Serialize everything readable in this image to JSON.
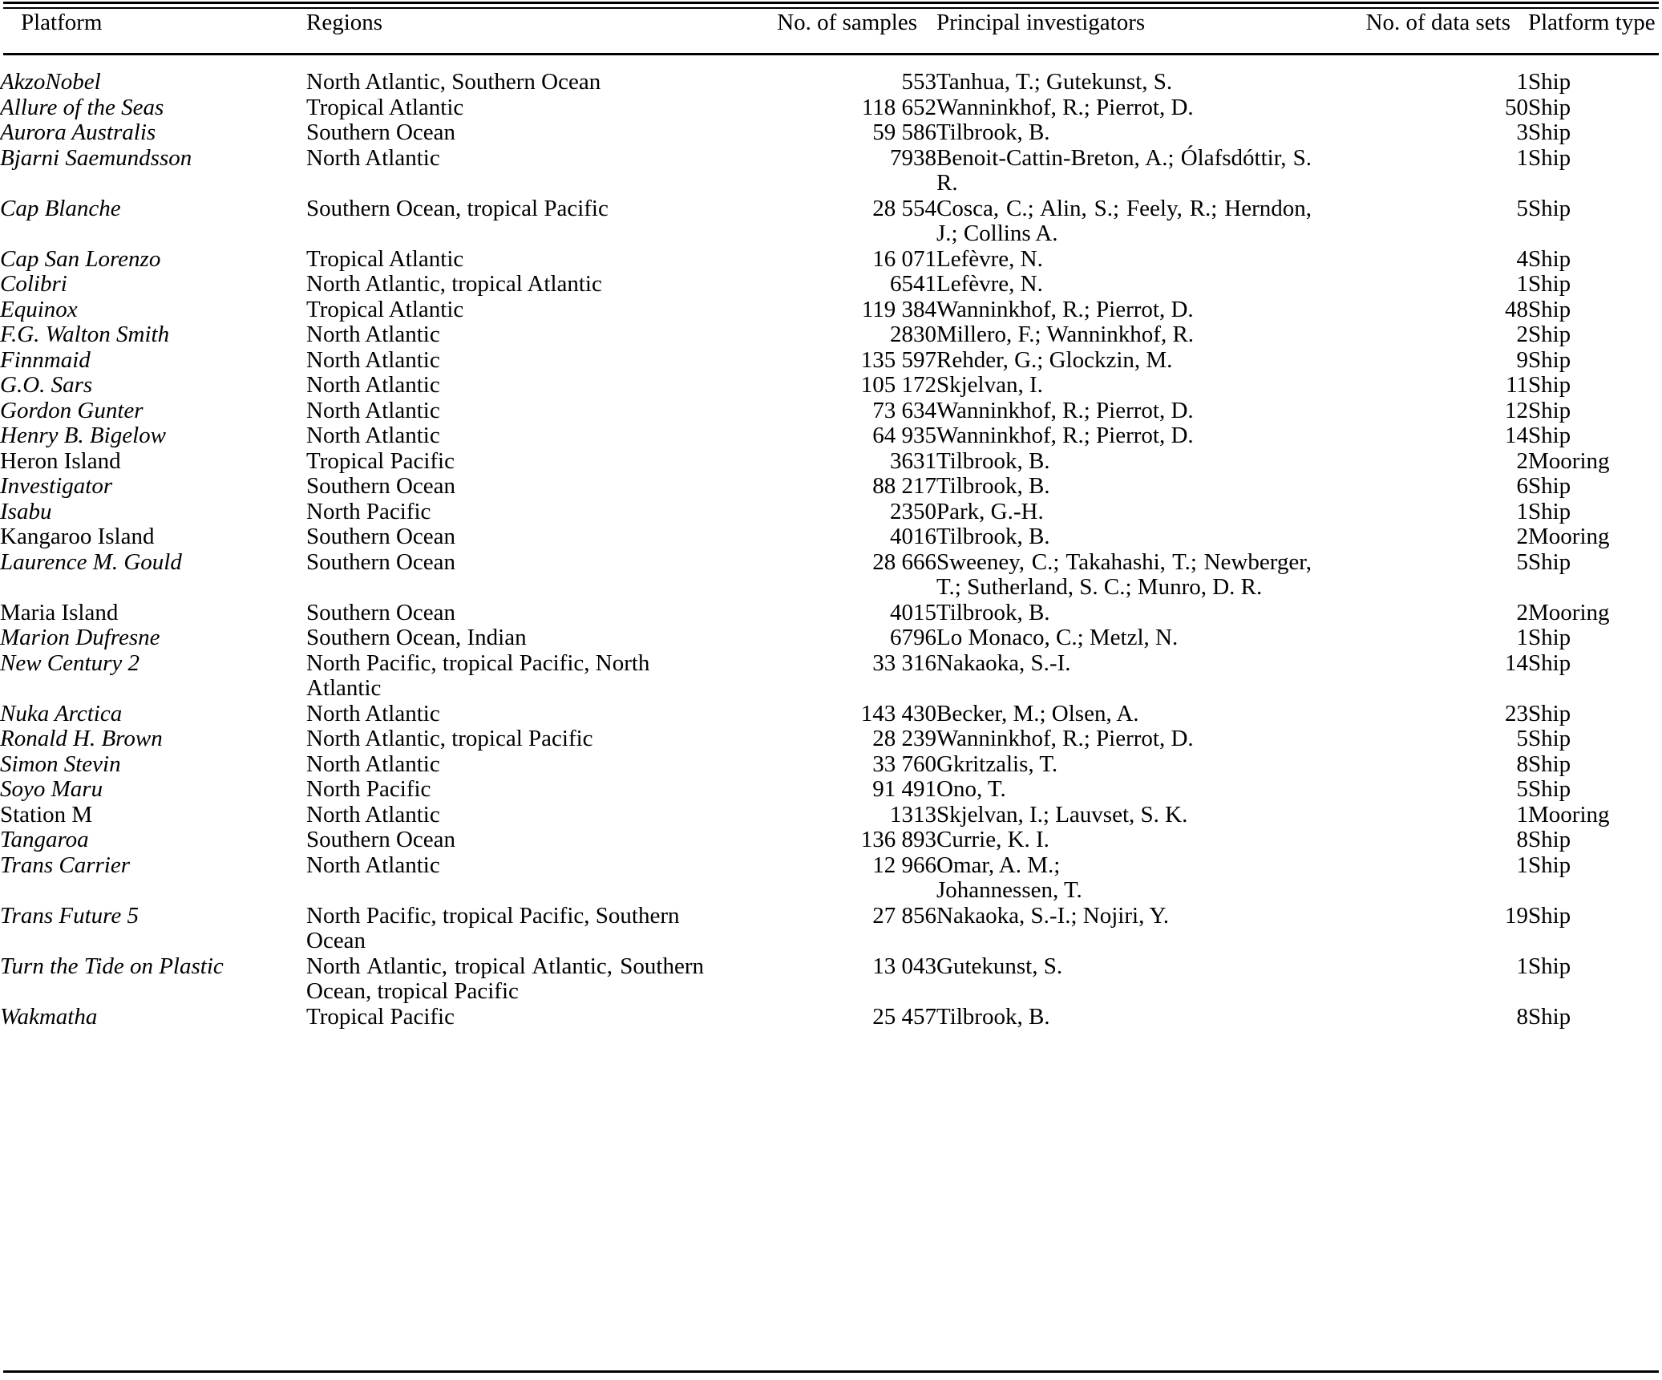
{
  "table": {
    "columns": [
      {
        "key": "platform",
        "label": "Platform"
      },
      {
        "key": "regions",
        "label": "Regions"
      },
      {
        "key": "samples",
        "label": "No. of samples"
      },
      {
        "key": "pi",
        "label": "Principal investigators"
      },
      {
        "key": "datasets",
        "label": "No. of data sets"
      },
      {
        "key": "type",
        "label": "Platform type"
      }
    ],
    "rows": [
      {
        "platform": "AkzoNobel",
        "italic": true,
        "regions": "North Atlantic, Southern Ocean",
        "samples": "553",
        "pi": "Tanhua, T.; Gutekunst, S.",
        "datasets": "1",
        "type": "Ship"
      },
      {
        "platform": "Allure of the Seas",
        "italic": true,
        "regions": "Tropical Atlantic",
        "samples": "118 652",
        "pi": "Wanninkhof, R.; Pierrot, D.",
        "datasets": "50",
        "type": "Ship"
      },
      {
        "platform": "Aurora Australis",
        "italic": true,
        "regions": "Southern Ocean",
        "samples": "59 586",
        "pi": "Tilbrook, B.",
        "datasets": "3",
        "type": "Ship"
      },
      {
        "platform": "Bjarni Saemundsson",
        "italic": true,
        "regions": "North Atlantic",
        "samples": "7938",
        "pi": "Benoit-Cattin-Breton, A.; Ólafsdóttir, S. R.",
        "pi_justify": true,
        "datasets": "1",
        "type": "Ship"
      },
      {
        "platform": "Cap Blanche",
        "italic": true,
        "regions": "Southern Ocean, tropical Pacific",
        "samples": "28 554",
        "pi": "Cosca, C.; Alin, S.; Feely, R.; Herndon, J.; Collins A.",
        "pi_justify": true,
        "datasets": "5",
        "type": "Ship"
      },
      {
        "platform": "Cap San Lorenzo",
        "italic": true,
        "regions": "Tropical Atlantic",
        "samples": "16 071",
        "pi": "Lefèvre, N.",
        "datasets": "4",
        "type": "Ship"
      },
      {
        "platform": "Colibri",
        "italic": true,
        "regions": "North Atlantic, tropical Atlantic",
        "samples": "6541",
        "pi": "Lefèvre, N.",
        "datasets": "1",
        "type": "Ship"
      },
      {
        "platform": "Equinox",
        "italic": true,
        "regions": "Tropical Atlantic",
        "samples": "119 384",
        "pi": "Wanninkhof, R.; Pierrot, D.",
        "datasets": "48",
        "type": "Ship"
      },
      {
        "platform": "F.G. Walton Smith",
        "italic": true,
        "regions": "North Atlantic",
        "samples": "2830",
        "pi": "Millero, F.; Wanninkhof, R.",
        "datasets": "2",
        "type": "Ship"
      },
      {
        "platform": "Finnmaid",
        "italic": true,
        "regions": "North Atlantic",
        "samples": "135 597",
        "pi": "Rehder, G.; Glockzin, M.",
        "datasets": "9",
        "type": "Ship"
      },
      {
        "platform": "G.O. Sars",
        "italic": true,
        "regions": "North Atlantic",
        "samples": "105 172",
        "pi": "Skjelvan, I.",
        "datasets": "11",
        "type": "Ship"
      },
      {
        "platform": "Gordon Gunter",
        "italic": true,
        "regions": "North Atlantic",
        "samples": "73 634",
        "pi": "Wanninkhof, R.; Pierrot, D.",
        "datasets": "12",
        "type": "Ship"
      },
      {
        "platform": "Henry B. Bigelow",
        "italic": true,
        "regions": "North Atlantic",
        "samples": "64 935",
        "pi": "Wanninkhof, R.; Pierrot, D.",
        "datasets": "14",
        "type": "Ship"
      },
      {
        "platform": "Heron Island",
        "italic": false,
        "regions": "Tropical Pacific",
        "samples": "3631",
        "pi": "Tilbrook, B.",
        "datasets": "2",
        "type": "Mooring"
      },
      {
        "platform": "Investigator",
        "italic": true,
        "regions": "Southern Ocean",
        "samples": "88 217",
        "pi": "Tilbrook, B.",
        "datasets": "6",
        "type": "Ship"
      },
      {
        "platform": "Isabu",
        "italic": true,
        "regions": "North Pacific",
        "samples": "2350",
        "pi": "Park, G.-H.",
        "datasets": "1",
        "type": "Ship"
      },
      {
        "platform": "Kangaroo Island",
        "italic": false,
        "regions": "Southern Ocean",
        "samples": "4016",
        "pi": "Tilbrook, B.",
        "datasets": "2",
        "type": "Mooring"
      },
      {
        "platform": "Laurence M. Gould",
        "italic": true,
        "regions": "Southern Ocean",
        "samples": "28 666",
        "pi": "Sweeney, C.; Takahashi, T.; Newberger, T.; Sutherland, S. C.; Munro, D. R.",
        "pi_justify": true,
        "datasets": "5",
        "type": "Ship"
      },
      {
        "platform": "Maria Island",
        "italic": false,
        "regions": "Southern Ocean",
        "samples": "4015",
        "pi": "Tilbrook, B.",
        "datasets": "2",
        "type": "Mooring"
      },
      {
        "platform": "Marion Dufresne",
        "italic": true,
        "regions": "Southern Ocean, Indian",
        "samples": "6796",
        "pi": "Lo Monaco, C.; Metzl, N.",
        "datasets": "1",
        "type": "Ship"
      },
      {
        "platform": "New Century 2",
        "italic": true,
        "regions": "North Pacific, tropical Pacific, North Atlantic",
        "regions_wrap": true,
        "samples": "33 316",
        "pi": "Nakaoka, S.-I.",
        "datasets": "14",
        "type": "Ship"
      },
      {
        "platform": "Nuka Arctica",
        "italic": true,
        "regions": "North Atlantic",
        "samples": "143 430",
        "pi": "Becker, M.; Olsen, A.",
        "datasets": "23",
        "type": "Ship"
      },
      {
        "platform": "Ronald H. Brown",
        "italic": true,
        "regions": "North Atlantic, tropical Pacific",
        "samples": "28 239",
        "pi": "Wanninkhof, R.; Pierrot, D.",
        "datasets": "5",
        "type": "Ship"
      },
      {
        "platform": "Simon Stevin",
        "italic": true,
        "regions": "North Atlantic",
        "samples": "33 760",
        "pi": "Gkritzalis, T.",
        "datasets": "8",
        "type": "Ship"
      },
      {
        "platform": "Soyo Maru",
        "italic": true,
        "regions": "North Pacific",
        "samples": "91 491",
        "pi": "Ono, T.",
        "datasets": "5",
        "type": "Ship"
      },
      {
        "platform": "Station M",
        "italic": false,
        "regions": "North Atlantic",
        "samples": "1313",
        "pi": "Skjelvan, I.; Lauvset, S. K.",
        "datasets": "1",
        "type": "Mooring"
      },
      {
        "platform": "Tangaroa",
        "italic": true,
        "regions": "Southern Ocean",
        "samples": "136 893",
        "pi": "Currie, K. I.",
        "datasets": "8",
        "type": "Ship"
      },
      {
        "platform": "Trans Carrier",
        "italic": true,
        "regions": "North Atlantic",
        "samples": "12 966",
        "pi": "Omar, A. M.;\nJohannessen, T.",
        "pi_break": true,
        "datasets": "1",
        "type": "Ship"
      },
      {
        "platform": "Trans Future 5",
        "italic": true,
        "regions": "North Pacific, tropical Pacific, Southern Ocean",
        "regions_wrap": true,
        "samples": "27 856",
        "pi": "Nakaoka, S.-I.; Nojiri, Y.",
        "datasets": "19",
        "type": "Ship"
      },
      {
        "platform": "Turn the Tide on Plastic",
        "italic": true,
        "regions": "North Atlantic, tropical Atlantic, Southern Ocean, tropical Pacific",
        "regions_justify": true,
        "samples": "13 043",
        "pi": "Gutekunst, S.",
        "datasets": "1",
        "type": "Ship"
      },
      {
        "platform": "Wakmatha",
        "italic": true,
        "regions": "Tropical Pacific",
        "samples": "25 457",
        "pi": "Tilbrook, B.",
        "datasets": "8",
        "type": "Ship"
      }
    ]
  }
}
